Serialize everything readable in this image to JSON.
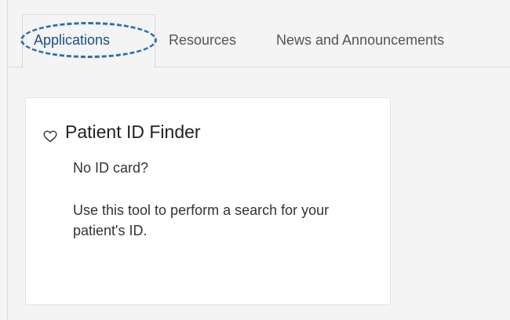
{
  "tabs": [
    {
      "label": "Applications",
      "active": true
    },
    {
      "label": "Resources",
      "active": false
    },
    {
      "label": "News and Announcements",
      "active": false
    }
  ],
  "card": {
    "icon": "heart-outline-icon",
    "title": "Patient ID Finder",
    "subtitle": "No ID card?",
    "description": "Use this tool to perform a search for your patient's ID."
  },
  "colors": {
    "active_tab_text": "#1a4f86",
    "highlight_oval": "#2e6db3",
    "page_background": "#f4f4f4",
    "card_background": "#ffffff"
  }
}
